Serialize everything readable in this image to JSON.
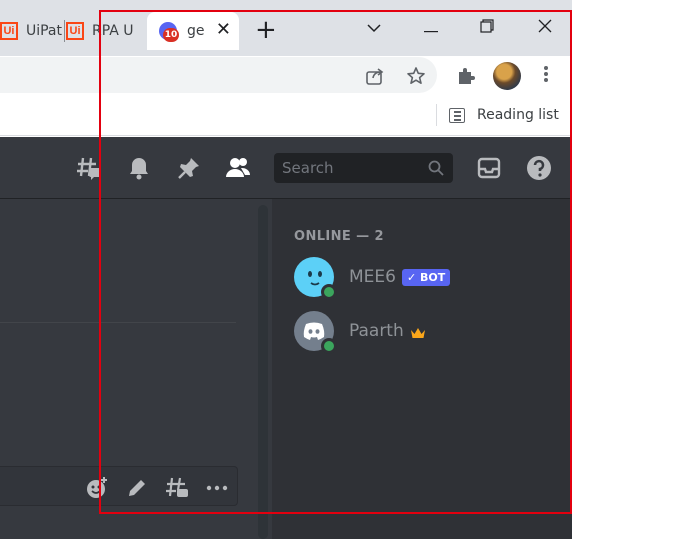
{
  "browser": {
    "tabs": [
      {
        "label": "UiPat",
        "icon": "uipath-favicon",
        "icon_text": "Ui"
      },
      {
        "label": "RPA U",
        "icon": "uipath-favicon",
        "icon_text": "Ui"
      },
      {
        "label": "ge",
        "icon": "discord-favicon",
        "badge": "10",
        "active": true
      }
    ],
    "new_tab_label": "+",
    "bookmarks": {
      "reading_list_label": "Reading list"
    }
  },
  "discord": {
    "search_placeholder": "Search",
    "members": {
      "heading": "ONLINE — 2",
      "list": [
        {
          "name": "MEE6",
          "tag": "✓ BOT",
          "avatar_color": "#5cd0f7",
          "status": "online"
        },
        {
          "name": "Paarth",
          "badge": "owner-crown",
          "avatar_color": "#747f8d",
          "status": "online"
        }
      ]
    }
  },
  "colors": {
    "discord_bg": "#36393f",
    "members_bg": "#2f3136",
    "online_green": "#3ba55d",
    "blurple": "#5865f2",
    "highlight_red": "#e3000f",
    "crown": "#faa61a"
  }
}
